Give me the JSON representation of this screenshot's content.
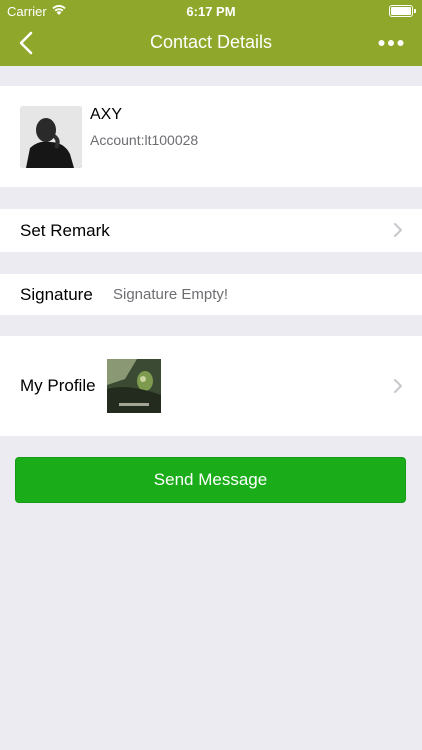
{
  "status_bar": {
    "carrier": "Carrier",
    "time": "6:17 PM"
  },
  "nav": {
    "title": "Contact Details",
    "back_icon": "chevron-left-icon",
    "more_icon": "ellipsis-icon"
  },
  "contact": {
    "name": "AXY",
    "account": "Account:lt100028"
  },
  "rows": {
    "remark_label": "Set Remark",
    "signature_label": "Signature",
    "signature_value": "Signature Empty!",
    "profile_label": "My Profile"
  },
  "actions": {
    "send_label": "Send Message"
  },
  "colors": {
    "nav_bg": "#8fa82c",
    "button_bg": "#1aad19",
    "page_bg": "#ebebf1"
  }
}
